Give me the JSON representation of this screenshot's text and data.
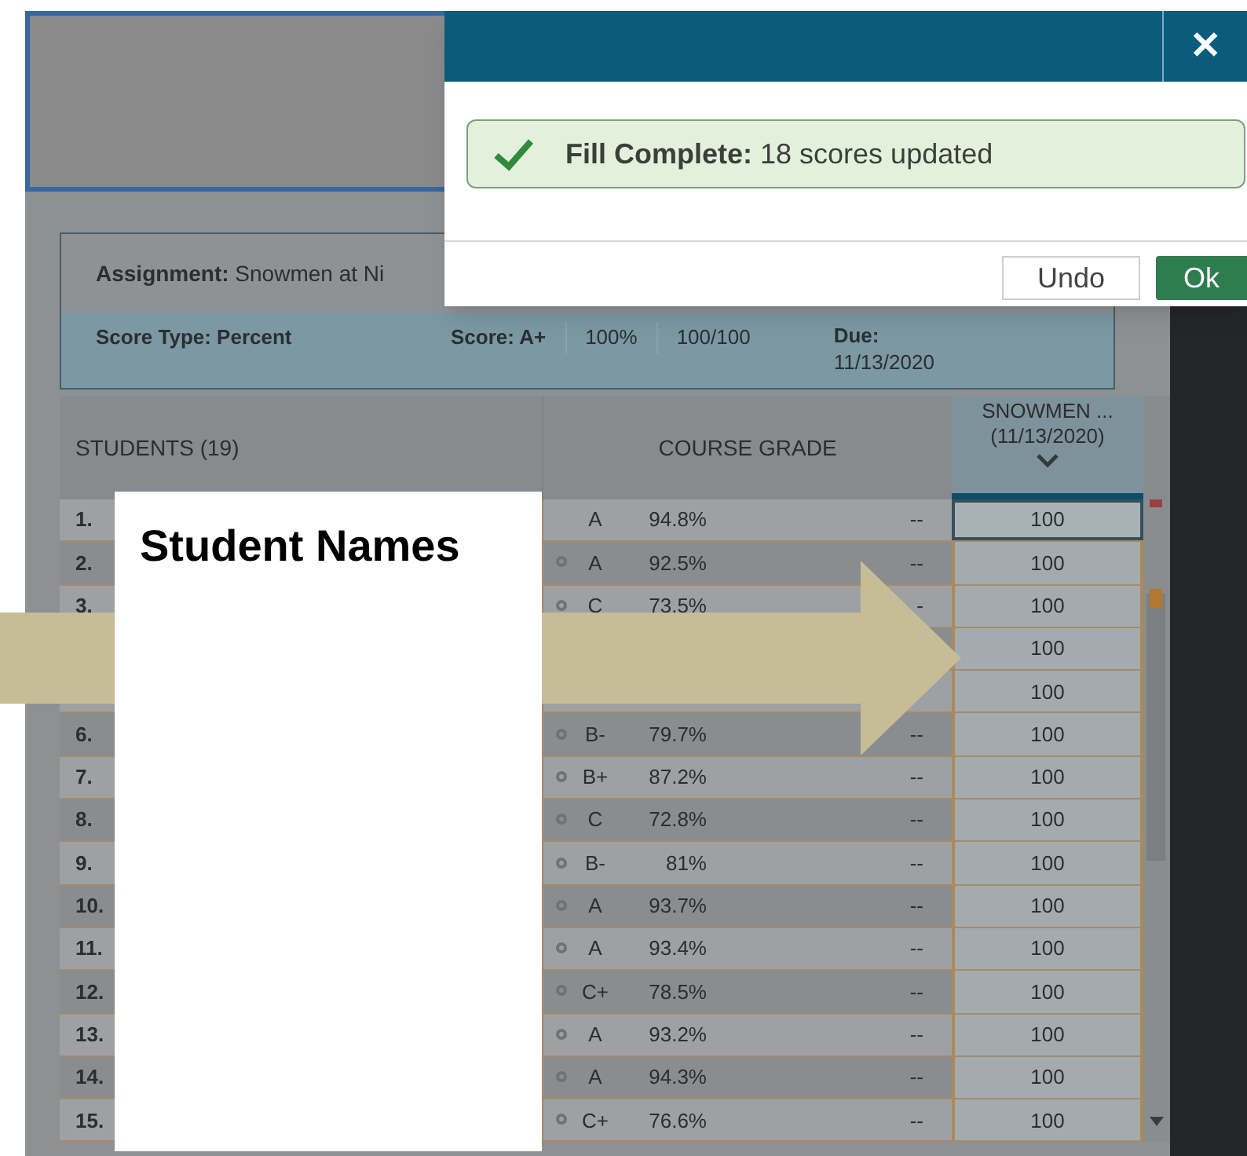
{
  "dialog": {
    "close": "✕",
    "alert": {
      "text": "**Fill Complete:** 18 scores updated"
    },
    "buttons": [
      {
        "label": "Undo",
        "kind": "secondary"
      },
      {
        "label": "Ok",
        "kind": "primary"
      }
    ]
  },
  "assignment": {
    "label": "Assignment:",
    "value": "Snowmen at Ni",
    "score_type_label": "Score Type:",
    "score_type": "Percent",
    "score_label": "Score:",
    "score_letter": "A+",
    "score_percent": "100%",
    "score_points": "100/100",
    "due_label": "Due:",
    "due": "11/13/2020"
  },
  "table": {
    "columns": {
      "students": "STUDENTS (19)",
      "grade": "COURSE GRADE",
      "assignment": "SNOWMEN ...",
      "assignment_date": "(11/13/2020)"
    },
    "rows": [
      {
        "number": "1.",
        "icon": false,
        "grade": "A",
        "percent": "94.8%",
        "dash": "--",
        "score": "100",
        "selected": true
      },
      {
        "number": "2.",
        "icon": true,
        "grade": "A",
        "percent": "92.5%",
        "dash": "--",
        "score": "100",
        "selected": false
      },
      {
        "number": "3.",
        "icon": true,
        "grade": "C",
        "percent": "73.5%",
        "dash": "-",
        "score": "100",
        "selected": false
      },
      {
        "icon": false,
        "score": "100",
        "selected": false
      },
      {
        "icon": false,
        "score": "100",
        "selected": false
      },
      {
        "number": "6.",
        "icon": true,
        "grade": "B-",
        "percent": "79.7%",
        "dash": "--",
        "score": "100",
        "selected": false
      },
      {
        "number": "7.",
        "icon": true,
        "grade": "B+",
        "percent": "87.2%",
        "dash": "--",
        "score": "100",
        "selected": false
      },
      {
        "number": "8.",
        "icon": true,
        "grade": "C",
        "percent": "72.8%",
        "dash": "--",
        "score": "100",
        "selected": false
      },
      {
        "number": "9.",
        "icon": true,
        "grade": "B-",
        "percent": "81%",
        "dash": "--",
        "score": "100",
        "selected": false
      },
      {
        "number": "10.",
        "icon": true,
        "grade": "A",
        "percent": "93.7%",
        "dash": "--",
        "score": "100",
        "selected": false
      },
      {
        "number": "11.",
        "icon": true,
        "grade": "A",
        "percent": "93.4%",
        "dash": "--",
        "score": "100",
        "selected": false
      },
      {
        "number": "12.",
        "icon": true,
        "grade": "C+",
        "percent": "78.5%",
        "dash": "--",
        "score": "100",
        "selected": false
      },
      {
        "number": "13.",
        "icon": true,
        "grade": "A",
        "percent": "93.2%",
        "dash": "--",
        "score": "100",
        "selected": false
      },
      {
        "number": "14.",
        "icon": true,
        "grade": "A",
        "percent": "94.3%",
        "dash": "--",
        "score": "100",
        "selected": false
      },
      {
        "number": "15.",
        "icon": true,
        "grade": "C+",
        "percent": "76.6%",
        "dash": "--",
        "score": "100",
        "selected": false
      }
    ]
  },
  "annotation": {
    "label": "Student Names"
  }
}
